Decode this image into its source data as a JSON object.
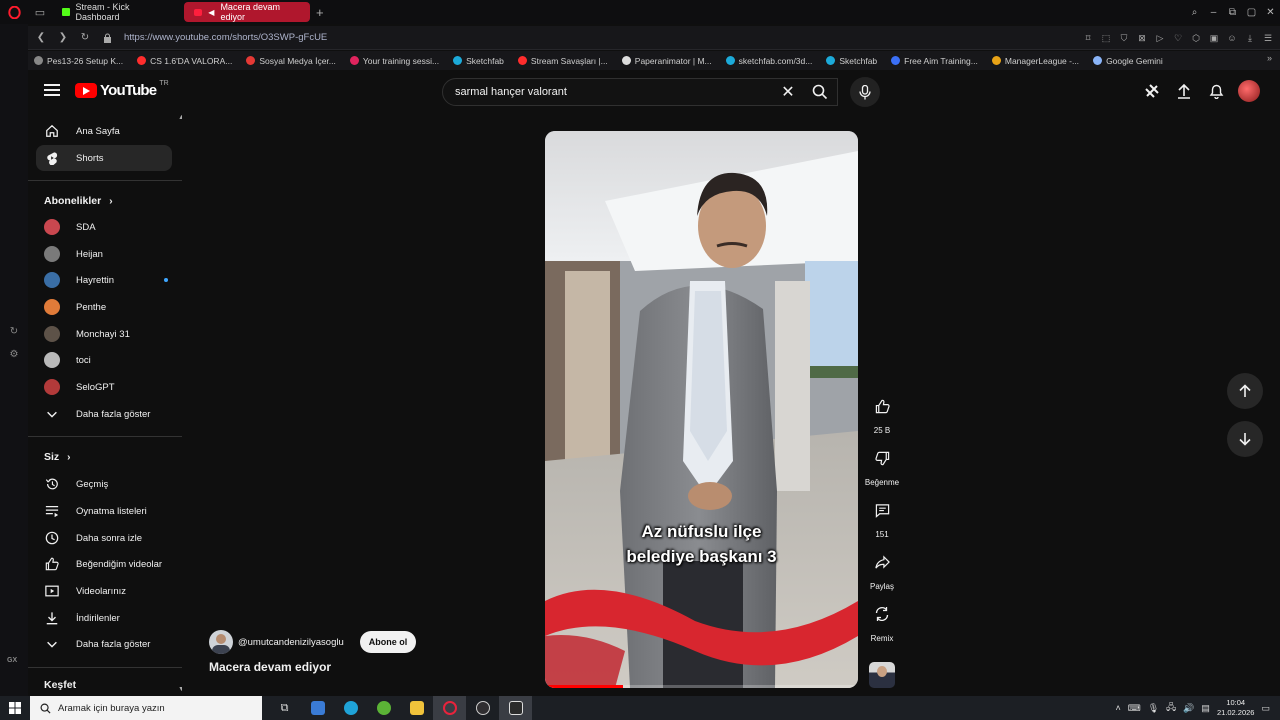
{
  "browser": {
    "tabs": [
      {
        "label": "Stream - Kick Dashboard"
      },
      {
        "label": "Macera devam ediyor"
      }
    ],
    "url": "https://www.youtube.com/shorts/O3SWP-gFcUE",
    "gx_label": "GX",
    "bookmarks": [
      {
        "label": "Pes13-26 Setup K...",
        "color": "#888888"
      },
      {
        "label": "CS 1.6'DA VALORA...",
        "color": "#ff2d2d"
      },
      {
        "label": "Sosyal Medya İçer...",
        "color": "#e53935"
      },
      {
        "label": "Your training sessi...",
        "color": "#e0245e"
      },
      {
        "label": "Sketchfab",
        "color": "#1caad9"
      },
      {
        "label": "Stream Savaşları |...",
        "color": "#ff2d2d"
      },
      {
        "label": "Paperanimator | M...",
        "color": "#dddddd"
      },
      {
        "label": "sketchfab.com/3d...",
        "color": "#1caad9"
      },
      {
        "label": "Sketchfab",
        "color": "#1caad9"
      },
      {
        "label": "Free Aim Training...",
        "color": "#3b6ff5"
      },
      {
        "label": "ManagerLeague -...",
        "color": "#e8a317"
      },
      {
        "label": "Google Gemini",
        "color": "#8ab4f8"
      }
    ]
  },
  "youtube": {
    "logo_text": "YouTube",
    "region": "TR",
    "search": {
      "value": "sarmal hançer valorant"
    },
    "guide": {
      "main": [
        {
          "label": "Ana Sayfa",
          "icon": "home-icon"
        },
        {
          "label": "Shorts",
          "icon": "shorts-icon"
        }
      ],
      "subs_title": "Abonelikler",
      "subs": [
        {
          "label": "SDA",
          "color": "#c9474f"
        },
        {
          "label": "Heijan",
          "color": "#7a7a7a"
        },
        {
          "label": "Hayrettin",
          "color": "#3a6ea5"
        },
        {
          "label": "Penthe",
          "color": "#e07b39"
        },
        {
          "label": "Monchayi 31",
          "color": "#5d5248"
        },
        {
          "label": "toci",
          "color": "#b9b9b9"
        },
        {
          "label": "SeloGPT",
          "color": "#b23a3a"
        }
      ],
      "subs_more": "Daha fazla göster",
      "you_title": "Siz",
      "you": [
        {
          "label": "Geçmiş",
          "icon": "history-icon"
        },
        {
          "label": "Oynatma listeleri",
          "icon": "playlist-icon"
        },
        {
          "label": "Daha sonra izle",
          "icon": "clock-icon"
        },
        {
          "label": "Beğendiğim videolar",
          "icon": "like-icon"
        },
        {
          "label": "Videolarınız",
          "icon": "video-icon"
        },
        {
          "label": "İndirilenler",
          "icon": "download-icon"
        }
      ],
      "you_more": "Daha fazla göster",
      "explore_title": "Keşfet"
    },
    "short": {
      "caption_line1": "Az nüfuslu ilçe",
      "caption_line2": "belediye başkanı 3",
      "progress": 0.25,
      "channel": "@umutcandenizilyasoglu",
      "subscribe": "Abone ol",
      "title": "Macera devam ediyor",
      "likes": "25 B",
      "dislike": "Beğenme",
      "comments": "151",
      "share": "Paylaş",
      "remix": "Remix"
    }
  },
  "taskbar": {
    "search_placeholder": "Aramak için buraya yazın",
    "time": "10:04",
    "date": "21.02.2026"
  }
}
